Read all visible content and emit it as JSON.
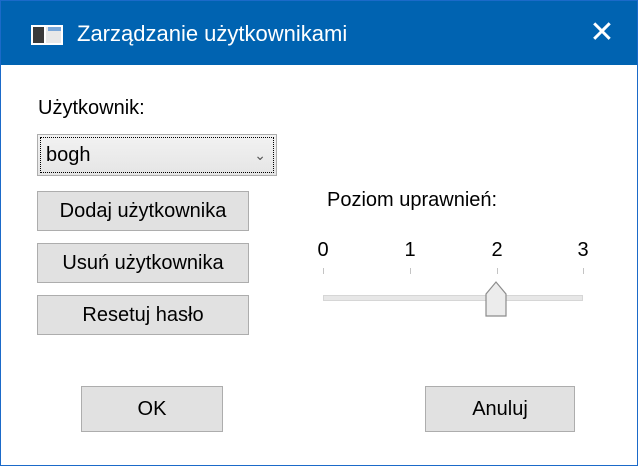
{
  "window": {
    "title": "Zarządzanie użytkownikami",
    "icon": "app-window-icon",
    "close_glyph": "✕"
  },
  "user_label": "Użytkownik:",
  "user_select": {
    "value": "bogh",
    "arrow": "⌄"
  },
  "buttons": {
    "add_user": "Dodaj użytkownika",
    "remove_user": "Usuń użytkownika",
    "reset_password": "Resetuj hasło",
    "ok": "OK",
    "cancel": "Anuluj"
  },
  "permission": {
    "label": "Poziom uprawnień:",
    "ticks": [
      "0",
      "1",
      "2",
      "3"
    ],
    "min": 0,
    "max": 3,
    "value": 2
  },
  "colors": {
    "titlebar": "#0063b1",
    "button_face": "#e1e1e1",
    "button_border": "#adadad"
  }
}
